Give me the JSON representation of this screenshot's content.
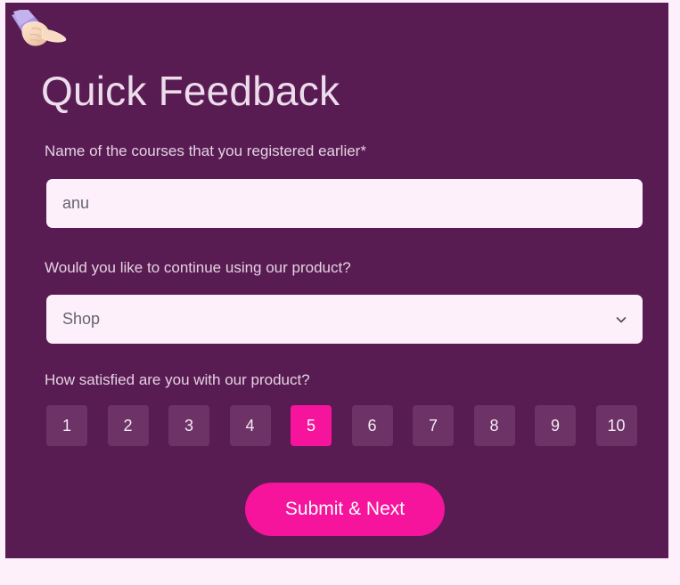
{
  "theme": {
    "card_background": "#591c52",
    "page_background": "#fdf0fb",
    "accent": "#f5149b",
    "field_background": "#fdf0fb",
    "rating_background": "#6d3266",
    "label_color": "#e3d2e2",
    "title_color": "#ecdcec"
  },
  "header": {
    "emoji_icon": "pointing-hand-emoji",
    "title": "Quick Feedback"
  },
  "fields": {
    "courses": {
      "label": "Name of the courses that you registered earlier*",
      "value": "anu",
      "placeholder": "anu"
    },
    "continue": {
      "label": "Would you like to continue using our product?",
      "selected": "Shop",
      "options": [
        "Shop"
      ],
      "chevron_icon": "chevron-down-icon"
    },
    "satisfaction": {
      "label": "How satisfied are you with our product?",
      "options": [
        "1",
        "2",
        "3",
        "4",
        "5",
        "6",
        "7",
        "8",
        "9",
        "10"
      ],
      "selected_index": 4,
      "selected_value": "5"
    }
  },
  "actions": {
    "submit_label": "Submit & Next"
  }
}
